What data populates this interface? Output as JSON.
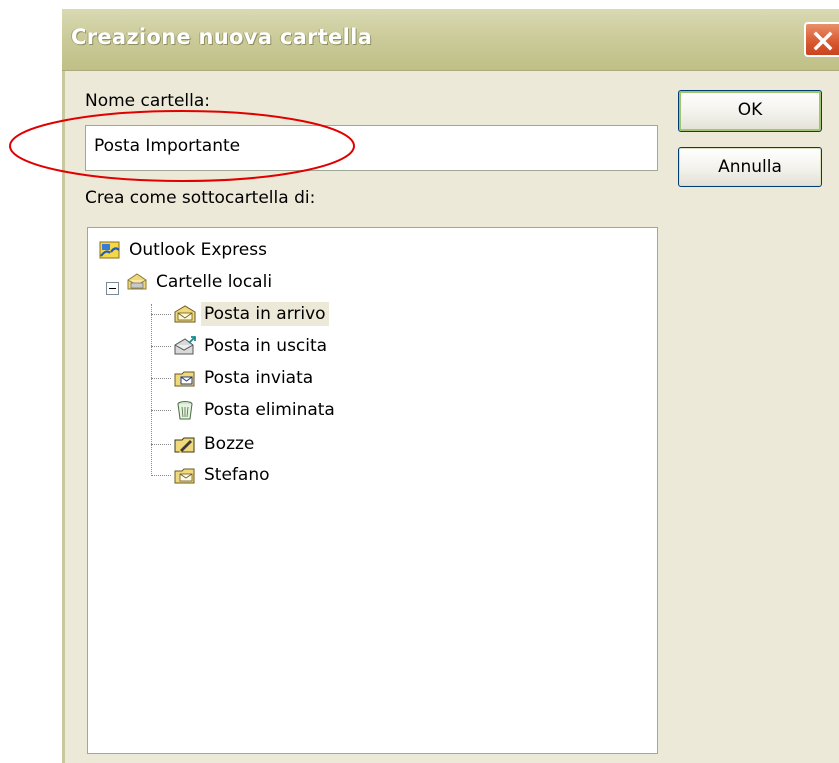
{
  "window": {
    "title": "Creazione nuova cartella"
  },
  "form": {
    "name_label": "Nome cartella:",
    "name_value": "Posta Importante",
    "parent_label": "Crea come sottocartella di:"
  },
  "buttons": {
    "ok_label": "OK",
    "cancel_label": "Annulla"
  },
  "tree": {
    "root": {
      "label": "Outlook Express",
      "icon": "outlook-express-icon"
    },
    "local": {
      "label": "Cartelle locali",
      "icon": "local-folders-icon",
      "expanded": true
    },
    "children": [
      {
        "label": "Posta in arrivo",
        "icon": "inbox-icon",
        "selected": true
      },
      {
        "label": "Posta in uscita",
        "icon": "outbox-icon",
        "selected": false
      },
      {
        "label": "Posta inviata",
        "icon": "sent-items-icon",
        "selected": false
      },
      {
        "label": "Posta eliminata",
        "icon": "deleted-items-icon",
        "selected": false
      },
      {
        "label": "Bozze",
        "icon": "drafts-icon",
        "selected": false
      },
      {
        "label": "Stefano",
        "icon": "folder-icon",
        "selected": false
      }
    ]
  },
  "colors": {
    "dialog_background": "#ece9d8",
    "title_bar": "#c7c793",
    "close_button": "#d8572f",
    "annotation_ellipse": "#e00000",
    "selection_background": "#ece9d8"
  }
}
